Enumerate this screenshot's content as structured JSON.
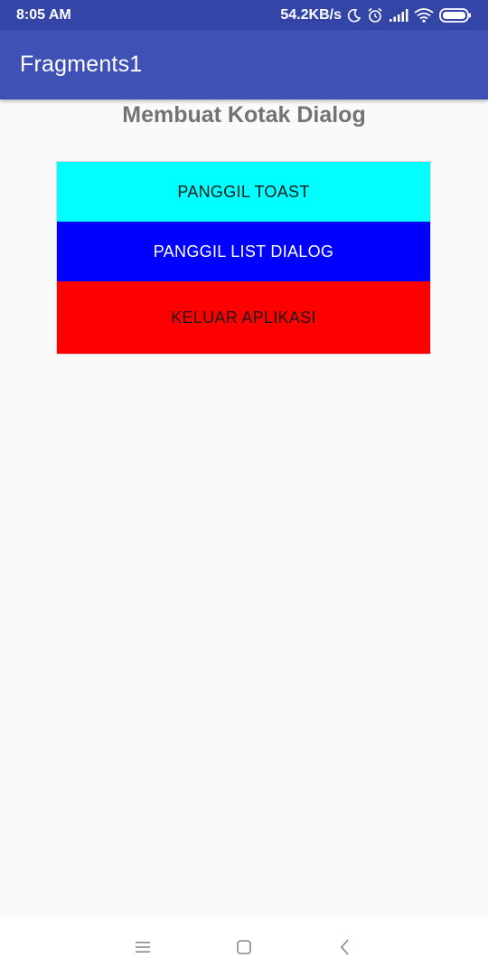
{
  "status_bar": {
    "time": "8:05 AM",
    "network_speed": "54.2KB/s",
    "icons": [
      "moon-icon",
      "alarm-icon",
      "signal-icon",
      "wifi-icon",
      "battery-icon"
    ]
  },
  "app_bar": {
    "title": "Fragments1"
  },
  "main": {
    "heading": "Membuat Kotak Dialog",
    "buttons": [
      {
        "label": "PANGGIL TOAST",
        "bg": "#00ffff",
        "fg": "#1a1a1a"
      },
      {
        "label": "PANGGIL LIST DIALOG",
        "bg": "#0000ff",
        "fg": "#ffffff"
      },
      {
        "label": "KELUAR APLIKASI",
        "bg": "#ff0000",
        "fg": "#1a1a1a"
      }
    ]
  },
  "nav_bar": {
    "icons": [
      "menu-icon",
      "home-icon",
      "back-icon"
    ]
  },
  "colors": {
    "status_bar": "#3346a8",
    "primary": "#3f51b5",
    "background": "#fafafa",
    "heading_text": "#737373"
  }
}
